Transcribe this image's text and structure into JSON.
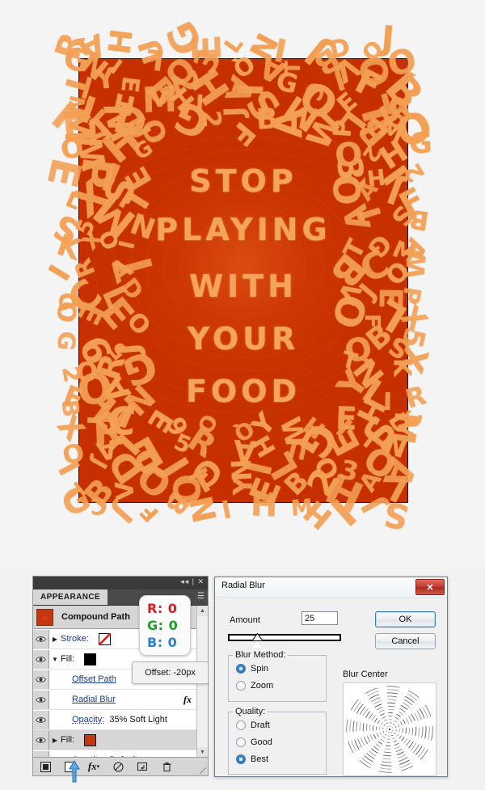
{
  "artwork": {
    "message_lines": [
      "STOP",
      "PLAYING",
      "WITH",
      "YOUR",
      "FOOD"
    ],
    "background_color": "#c63000",
    "letter_color": "#f3a055",
    "border_letters": "RAHUGELNIJDOJGNILO3QATBVOQTYEB2HAIGCJFBNIHMHIJSMOELSKIDOG2FBAWPX5XRCE6OQYWHISMOALE5"
  },
  "appearance_panel": {
    "tab_label": "APPEARANCE",
    "collapse_icon": "collapse-icon",
    "close_icon": "close-icon",
    "menu_icon": "panel-menu-icon",
    "object_type": "Compound Path",
    "rows": [
      {
        "label": "Stroke:",
        "value": "",
        "swatch": "none",
        "disclosure": "collapsed",
        "eye": true
      },
      {
        "label": "Fill:",
        "value": "",
        "swatch": "black",
        "disclosure": "expanded",
        "eye": true
      },
      {
        "label": "Offset Path",
        "value": "",
        "swatch": "",
        "disclosure": "",
        "eye": true
      },
      {
        "label": "Radial Blur",
        "value": "",
        "swatch": "",
        "disclosure": "",
        "eye": true,
        "fx": "fx"
      },
      {
        "label": "Opacity:",
        "value": "35% Soft Light",
        "swatch": "",
        "disclosure": "",
        "eye": true
      },
      {
        "label": "Fill:",
        "value": "",
        "swatch": "orange",
        "disclosure": "collapsed",
        "eye": true,
        "selected": true
      },
      {
        "label": "Opacity:",
        "value": "Default",
        "swatch": "",
        "disclosure": "",
        "eye": true
      }
    ],
    "bottom_buttons": [
      "add-new-stroke-button",
      "add-new-fill-button",
      "add-new-effect-button",
      "clear-appearance-button",
      "duplicate-item-button",
      "delete-item-button"
    ]
  },
  "rgb_callout": {
    "r": "R: 0",
    "g": "G: 0",
    "b": "B: 0",
    "r_color": "#e01b1b",
    "g_color": "#1e9e2a",
    "b_color": "#2d7fd1"
  },
  "offset_callout": {
    "text": "Offset: -20px"
  },
  "radial_blur_dialog": {
    "title": "Radial Blur",
    "close_label": "✕",
    "amount_label": "Amount",
    "amount_value": "25",
    "blur_method": {
      "legend": "Blur Method:",
      "options": [
        {
          "label": "Spin",
          "selected": true
        },
        {
          "label": "Zoom",
          "selected": false
        }
      ]
    },
    "quality": {
      "legend": "Quality:",
      "options": [
        {
          "label": "Draft",
          "selected": false
        },
        {
          "label": "Good",
          "selected": false
        },
        {
          "label": "Best",
          "selected": true
        }
      ]
    },
    "blur_center_label": "Blur Center",
    "ok_label": "OK",
    "cancel_label": "Cancel"
  }
}
